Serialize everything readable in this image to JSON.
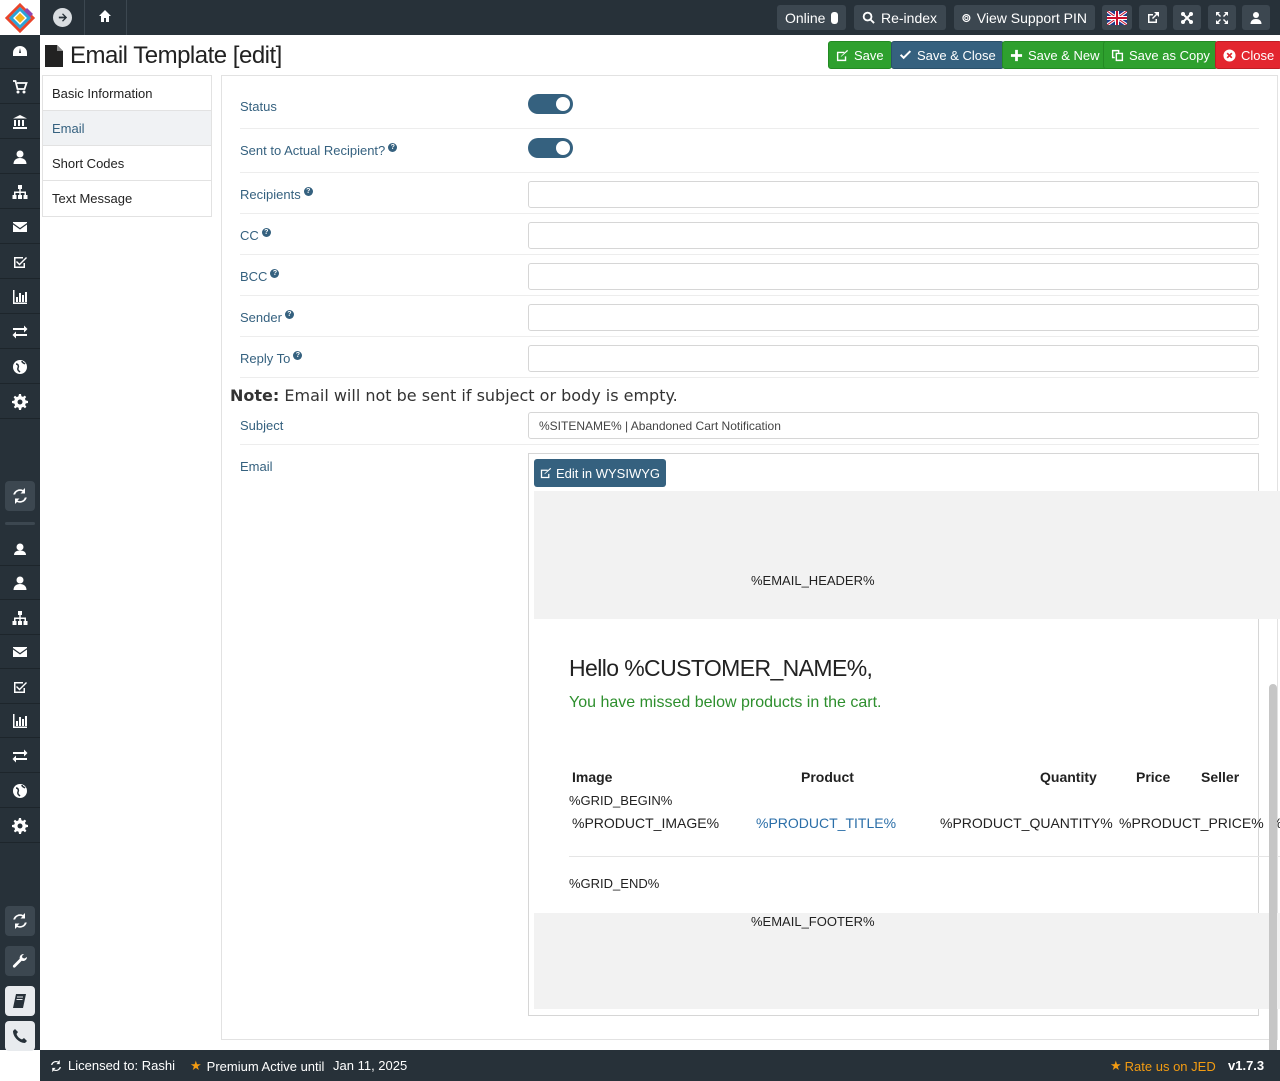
{
  "topbar": {
    "online_label": "Online",
    "reindex_label": "Re-index",
    "support_pin_label": "View Support PIN"
  },
  "header": {
    "title": "Email Template [edit]",
    "buttons": {
      "save": "Save",
      "save_close": "Save & Close",
      "save_new": "Save & New",
      "save_copy": "Save as Copy",
      "close": "Close"
    }
  },
  "tabs": [
    {
      "label": "Basic Information"
    },
    {
      "label": "Email"
    },
    {
      "label": "Short Codes"
    },
    {
      "label": "Text Message"
    }
  ],
  "form": {
    "status_label": "Status",
    "status_on": true,
    "sent_actual_label": "Sent to Actual Recipient?",
    "sent_actual_on": true,
    "recipients_label": "Recipients",
    "recipients_value": "",
    "cc_label": "CC",
    "cc_value": "",
    "bcc_label": "BCC",
    "bcc_value": "",
    "sender_label": "Sender",
    "sender_value": "",
    "reply_to_label": "Reply To",
    "reply_to_value": "",
    "note_strong": "Note:",
    "note_text": " Email will not be sent if subject or body is empty.",
    "subject_label": "Subject",
    "subject_value": "%SITENAME% | Abandoned Cart Notification",
    "email_label": "Email"
  },
  "editor": {
    "wysiwyg_label": "Edit in WYSIWYG",
    "header_code": "%EMAIL_HEADER%",
    "greeting": "Hello %CUSTOMER_NAME%,",
    "missed_text": "You have missed below products in the cart.",
    "columns": {
      "image": "Image",
      "product": "Product",
      "quantity": "Quantity",
      "price": "Price",
      "seller": "Seller"
    },
    "grid_begin": "%GRID_BEGIN%",
    "product_image": "%PRODUCT_IMAGE%",
    "product_title": "%PRODUCT_TITLE%",
    "product_quantity": "%PRODUCT_QUANTITY%",
    "product_price": "%PRODUCT_PRICE%",
    "seller_partial": "%",
    "grid_end": "%GRID_END%",
    "footer_code": "%EMAIL_FOOTER%"
  },
  "footer": {
    "licensed": "Licensed to: Rashi",
    "premium": "Premium Active until",
    "premium_date": "Jan 11, 2025",
    "rate_jed": "Rate us on JED",
    "version": "v1.7.3"
  },
  "colors": {
    "dark": "#273139",
    "primary": "#35617f",
    "success": "#2ea02e",
    "danger": "#e3262f",
    "warning": "#f39c12"
  }
}
